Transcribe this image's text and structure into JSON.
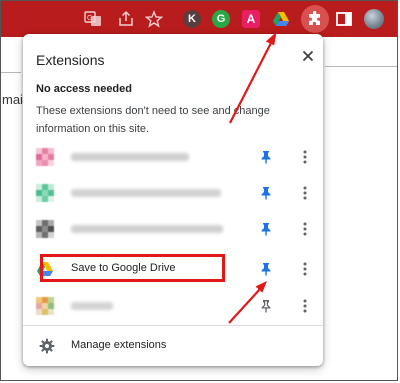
{
  "toolbar": {
    "icons": [
      {
        "name": "translate-icon"
      },
      {
        "name": "share-icon"
      },
      {
        "name": "bookmark-star-icon"
      },
      {
        "name": "extension-k-icon",
        "letter": "K"
      },
      {
        "name": "extension-g-icon",
        "letter": "G"
      },
      {
        "name": "extension-a-icon",
        "letter": "A"
      },
      {
        "name": "google-drive-icon"
      },
      {
        "name": "extensions-puzzle-icon"
      },
      {
        "name": "side-panel-icon"
      },
      {
        "name": "profile-avatar"
      }
    ],
    "colors": {
      "background": "#b81c1c",
      "puzzle_active": "#d85050"
    }
  },
  "background_page": {
    "partial_text": "mail"
  },
  "popup": {
    "title": "Extensions",
    "section_title": "No access needed",
    "section_description": "These extensions don't need to see and change information on this site.",
    "extensions": [
      {
        "name": "",
        "blurred": true,
        "pinned": true,
        "icon": "blurred-pink-icon"
      },
      {
        "name": "",
        "blurred": true,
        "pinned": true,
        "icon": "blurred-green-icon"
      },
      {
        "name": "",
        "blurred": true,
        "pinned": true,
        "icon": "blurred-gray-icon"
      },
      {
        "name": "Save to Google Drive",
        "blurred": false,
        "pinned": true,
        "icon": "google-drive-icon",
        "highlighted": true
      },
      {
        "name": "",
        "blurred": true,
        "pinned": false,
        "icon": "blurred-multicolor-icon"
      }
    ],
    "manage_label": "Manage extensions"
  },
  "colors": {
    "pin_active": "#1a73e8",
    "pin_inactive": "#5f6368",
    "highlight": "#e01818",
    "arrow": "#e01818"
  }
}
